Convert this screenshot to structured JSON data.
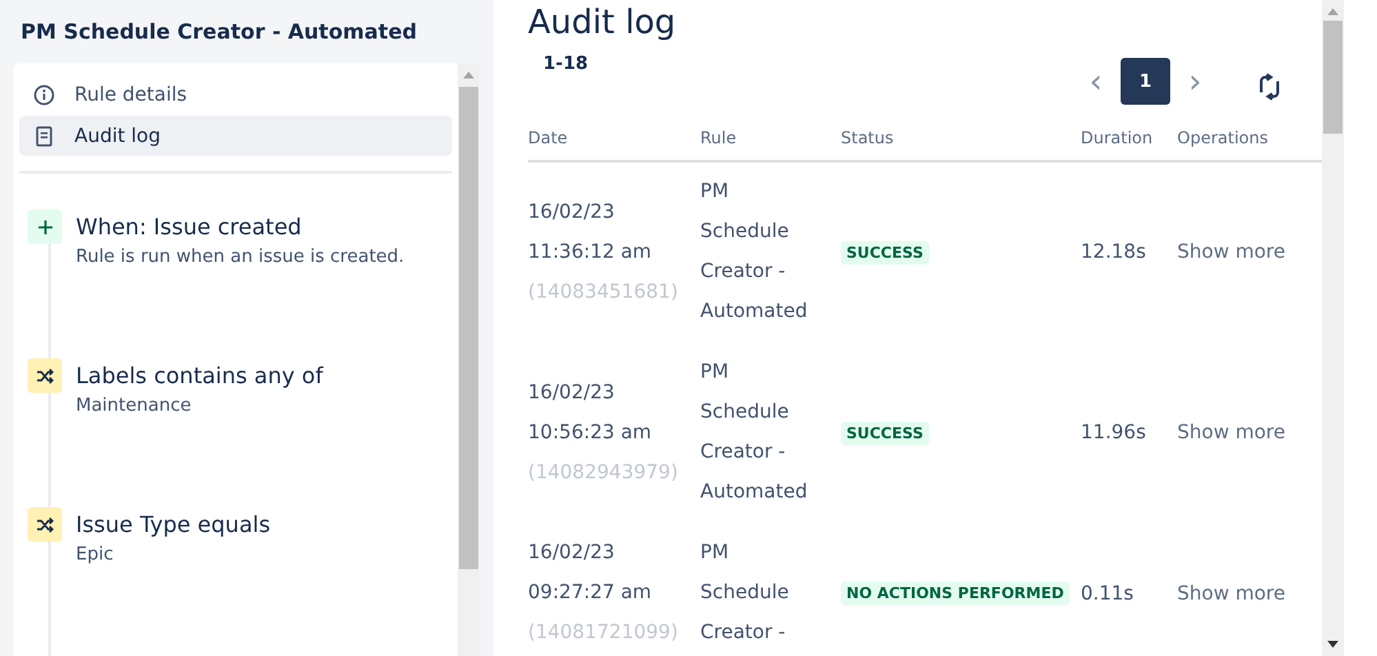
{
  "sidebar": {
    "title": "PM Schedule Creator - Automated",
    "nav": [
      {
        "label": "Rule details",
        "kind": "info",
        "selected": false
      },
      {
        "label": "Audit log",
        "kind": "document",
        "selected": true
      }
    ],
    "steps": [
      {
        "kind": "trigger",
        "title": "When: Issue created",
        "detail": "Rule is run when an issue is created."
      },
      {
        "kind": "condition",
        "title": "Labels contains any of",
        "detail": "Maintenance"
      },
      {
        "kind": "condition",
        "title": "Issue Type equals",
        "detail": "Epic"
      }
    ]
  },
  "main": {
    "title": "Audit log",
    "range": "1-18",
    "pagination": {
      "prev": "‹",
      "next": "›",
      "pages": [
        {
          "label": "1",
          "selected": true
        }
      ]
    },
    "table": {
      "columns": [
        "Date",
        "Rule",
        "Status",
        "Duration",
        "Operations"
      ],
      "rows": [
        {
          "date": "16/02/23",
          "time": "11:36:12 am",
          "id": "(14083451681)",
          "rule": [
            "PM",
            "Schedule",
            "Creator -",
            "Automated"
          ],
          "status": "SUCCESS",
          "duration": "12.18s",
          "action": "Show more"
        },
        {
          "date": "16/02/23",
          "time": "10:56:23 am",
          "id": "(14082943979)",
          "rule": [
            "PM",
            "Schedule",
            "Creator -",
            "Automated"
          ],
          "status": "SUCCESS",
          "duration": "11.96s",
          "action": "Show more"
        },
        {
          "date": "16/02/23",
          "time": "09:27:27 am",
          "id": "(14081721099)",
          "rule": [
            "PM",
            "Schedule",
            "Creator -"
          ],
          "status": "NO ACTIONS PERFORMED",
          "duration": "0.11s",
          "action": "Show more"
        }
      ]
    }
  }
}
